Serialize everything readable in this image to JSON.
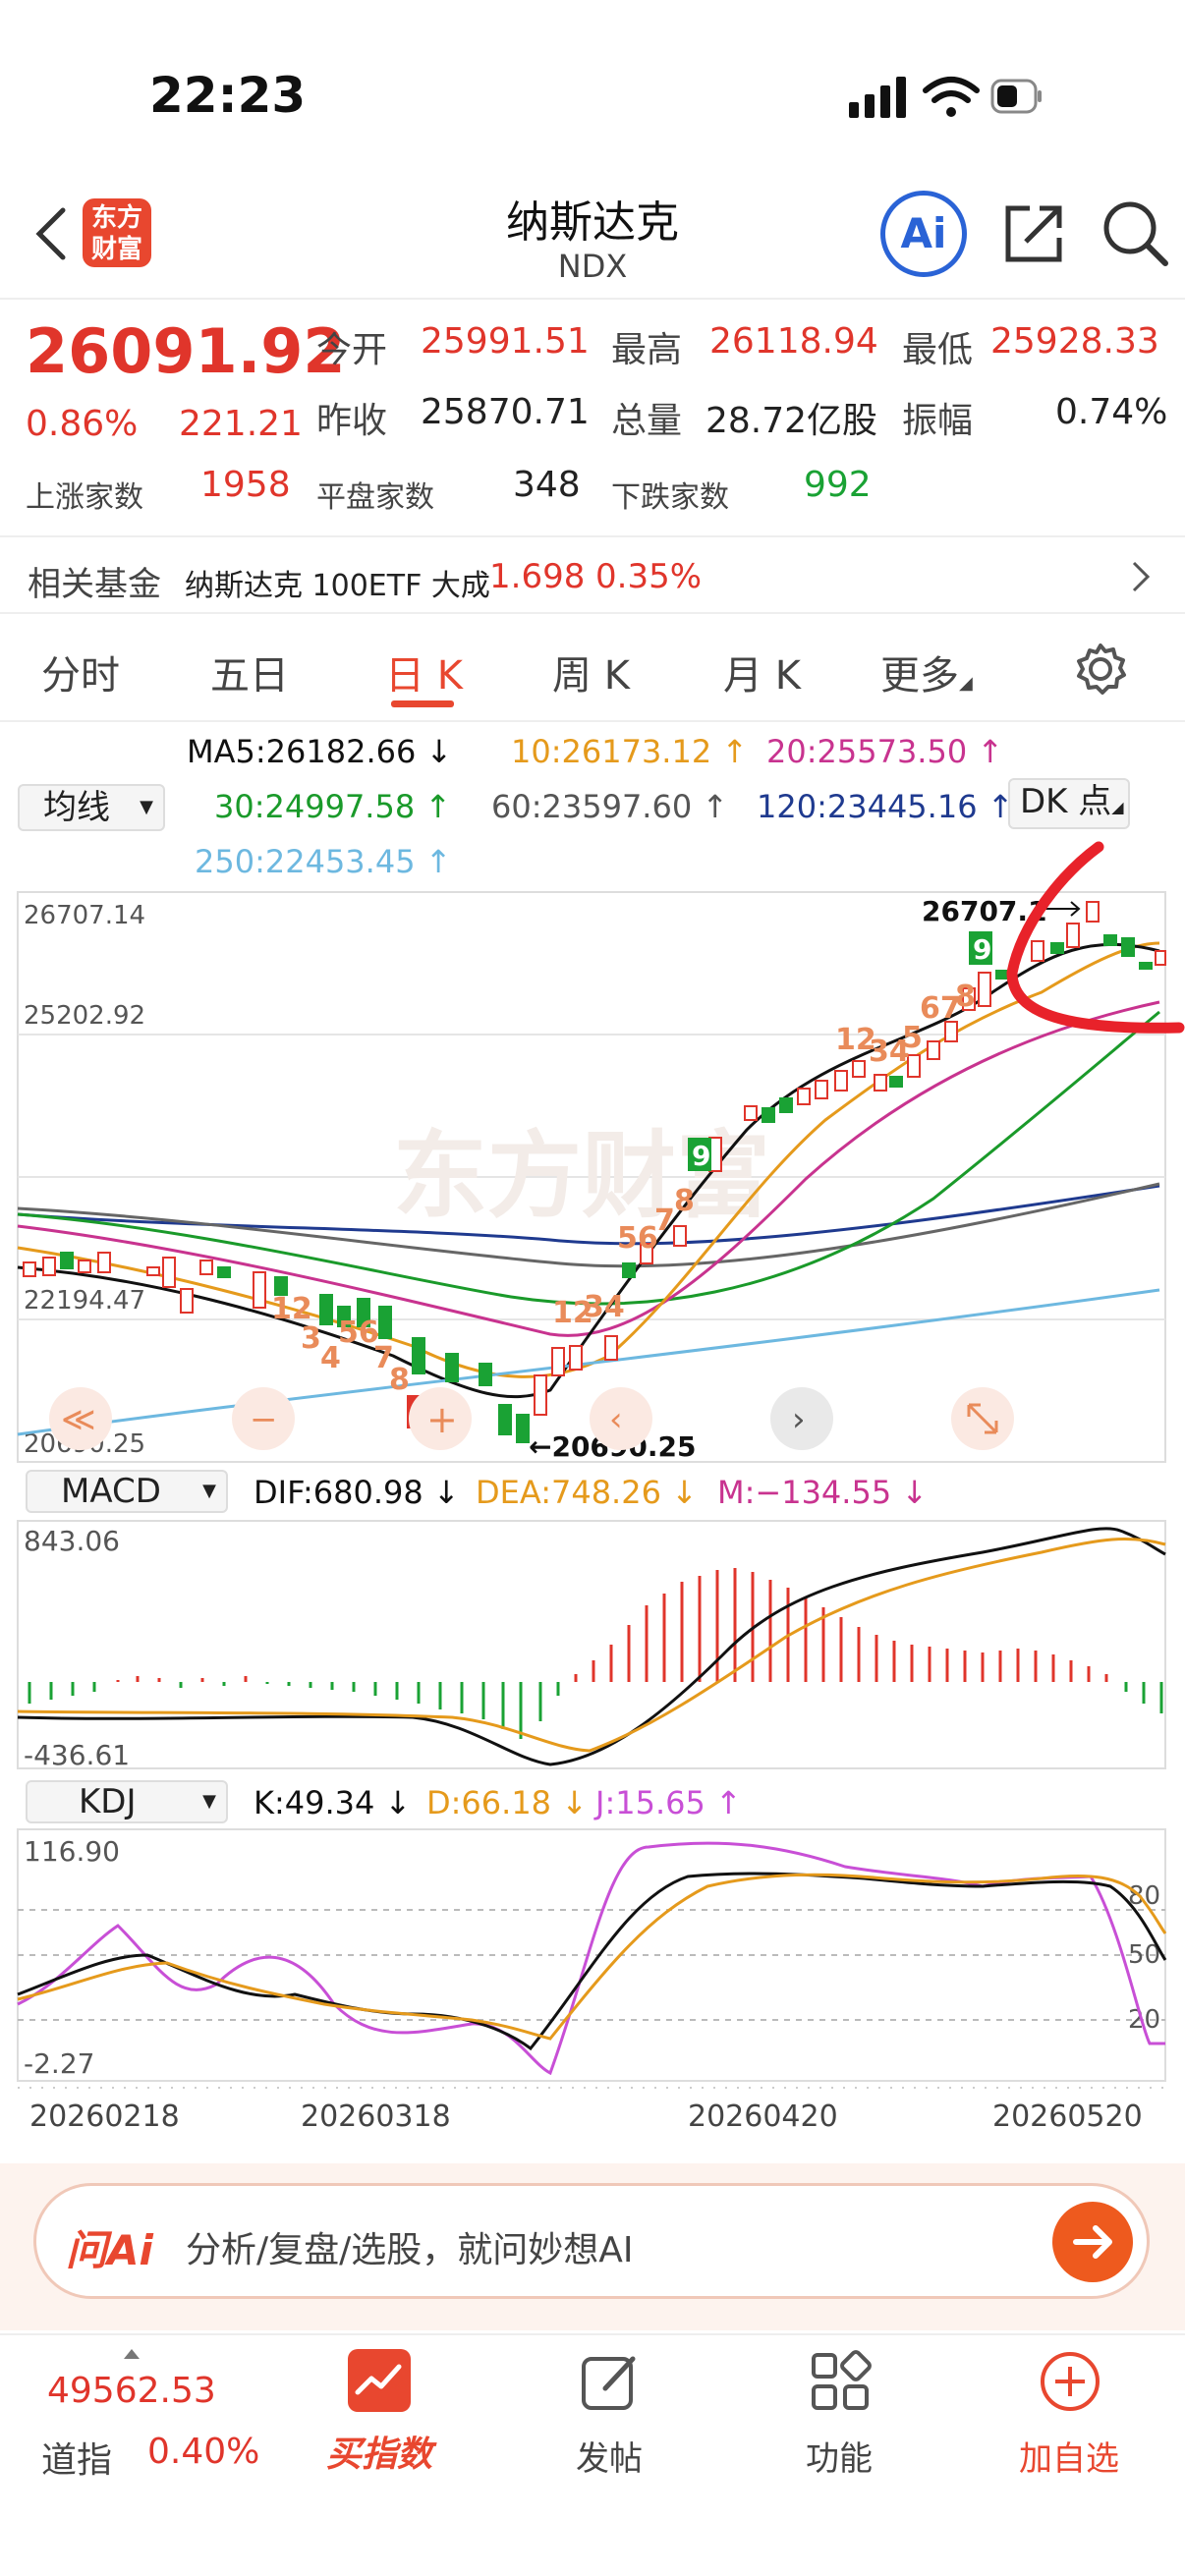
{
  "status": {
    "time": "22:23"
  },
  "header": {
    "logo_text_1": "东方",
    "logo_text_2": "财富",
    "title": "纳斯达克",
    "code": "NDX",
    "ai_label": "Ai"
  },
  "quote": {
    "price": "26091.92",
    "change_pct": "0.86%",
    "change": "221.21",
    "open_label": "今开",
    "open": "25991.51",
    "high_label": "最高",
    "high": "26118.94",
    "low_label": "最低",
    "low": "25928.33",
    "prev_label": "昨收",
    "prev": "25870.71",
    "volume_label": "总量",
    "volume": "28.72亿股",
    "amp_label": "振幅",
    "amp": "0.74%",
    "up_label": "上涨家数",
    "up": "1958",
    "flat_label": "平盘家数",
    "flat": "348",
    "down_label": "下跌家数",
    "down": "992"
  },
  "fund": {
    "label": "相关基金",
    "name": "纳斯达克 100ETF 大成",
    "price": "1.698",
    "pct": "0.35%"
  },
  "tabs": [
    "分时",
    "五日",
    "日 K",
    "周 K",
    "月 K",
    "更多"
  ],
  "ma": {
    "selector": "均线",
    "ma5": "MA5:26182.66 ↓",
    "ma10": "10:26173.12 ↑",
    "ma20": "20:25573.50 ↑",
    "ma30": "30:24997.58 ↑",
    "ma60": "60:23597.60 ↑",
    "ma120": "120:23445.16 ↑",
    "ma250": "250:22453.45 ↑",
    "dk": "DK 点"
  },
  "main_chart": {
    "y_top": "26707.14",
    "y_mid": "25202.92",
    "y_low": "22194.47",
    "y_bottom": "20690.25",
    "high_mark": "26707.1",
    "low_mark": "←20690.25",
    "watermark": "东方财富"
  },
  "macd": {
    "selector": "MACD",
    "dif": "DIF:680.98 ↓",
    "dea": "DEA:748.26 ↓",
    "m": "M:−134.55 ↓",
    "y_top": "843.06",
    "y_bottom": "-436.61"
  },
  "kdj": {
    "selector": "KDJ",
    "k": "K:49.34 ↓",
    "d": "D:66.18 ↓",
    "j": "J:15.65 ↑",
    "y_top": "116.90",
    "y_bottom": "-2.27",
    "l80": "80",
    "l50": "50",
    "l20": "20"
  },
  "dates": [
    "20260218",
    "20260318",
    "20260420",
    "20260520"
  ],
  "ai_bar": {
    "logo": "问Ai",
    "placeholder": "分析/复盘/选股，就问妙想AI"
  },
  "tabbar": {
    "index_value": "49562.53",
    "index_name": "道指",
    "index_pct": "0.40%",
    "buy_index": "买指数",
    "post": "发帖",
    "functions": "功能",
    "add_watch": "加自选"
  },
  "colors": {
    "up": "#e0352b",
    "down": "#1aa234",
    "accent": "#e8472f",
    "ma5": "#111111",
    "ma10": "#e59a1c",
    "ma20": "#c8338f",
    "ma30": "#1a9a2a",
    "ma60": "#666666",
    "ma120": "#1f3a8f",
    "ma250": "#6db8e0"
  }
}
